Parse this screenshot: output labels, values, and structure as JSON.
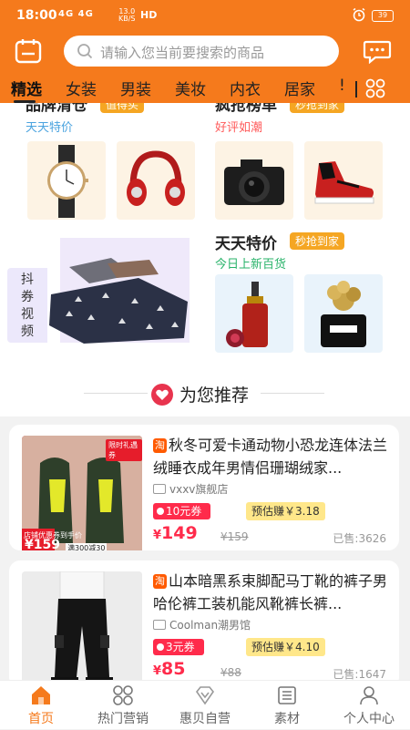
{
  "status_bar": {
    "time": "18:00",
    "network": "4G 4G",
    "speed_value": "13.0",
    "speed_unit": "KB/S",
    "hd": "HD",
    "battery": "39"
  },
  "header": {
    "search_placeholder": "请输入您当前要搜索的商品",
    "accent_color": "#f57a1c"
  },
  "tabs": [
    {
      "label": "精选",
      "active": true
    },
    {
      "label": "女装"
    },
    {
      "label": "男装"
    },
    {
      "label": "美妆"
    },
    {
      "label": "内衣"
    },
    {
      "label": "居家"
    },
    {
      "label": "!"
    }
  ],
  "sections": {
    "pinpai": {
      "title": "品牌清仓",
      "badge": "值得买",
      "subtitle": "天天特价"
    },
    "fengqiang": {
      "title": "疯抢榜单",
      "badge": "秒抢到家",
      "subtitle": "好评如潮"
    },
    "tiantian": {
      "title": "天天特价",
      "badge": "秒抢到家",
      "subtitle": "今日上新百货"
    },
    "douquan": {
      "label_1": "抖",
      "label_2": "券",
      "label_3": "视",
      "label_4": "频"
    }
  },
  "recommend": {
    "title": "为您推荐"
  },
  "products": [
    {
      "tag": "淘",
      "title": "秋冬可爱卡通动物小恐龙连体法兰绒睡衣成年男情侣珊瑚绒家...",
      "shop": "vxxv旗舰店",
      "coupon": "10元券",
      "earn": "预估赚￥3.18",
      "price_symbol": "¥",
      "price": "149",
      "original_price": "¥159",
      "sold": "已售:3626",
      "img_price": "¥159",
      "img_badge": "限时礼遇券",
      "img_note": "店铺优惠券到手价",
      "img_note2": "满300减30"
    },
    {
      "tag": "淘",
      "title": "山本暗黑系束脚配马丁靴的裤子男哈伦裤工装机能风靴裤长裤...",
      "shop": "Coolman潮男馆",
      "coupon": "3元券",
      "earn": "预估赚￥4.10",
      "price_symbol": "¥",
      "price": "85",
      "original_price": "¥88",
      "sold": "已售:1647"
    }
  ],
  "bottom_nav": [
    {
      "label": "首页",
      "icon": "home-icon",
      "active": true
    },
    {
      "label": "热门营销",
      "icon": "grid-icon"
    },
    {
      "label": "惠贝自营",
      "icon": "diamond-icon"
    },
    {
      "label": "素材",
      "icon": "list-icon"
    },
    {
      "label": "个人中心",
      "icon": "person-icon"
    }
  ]
}
